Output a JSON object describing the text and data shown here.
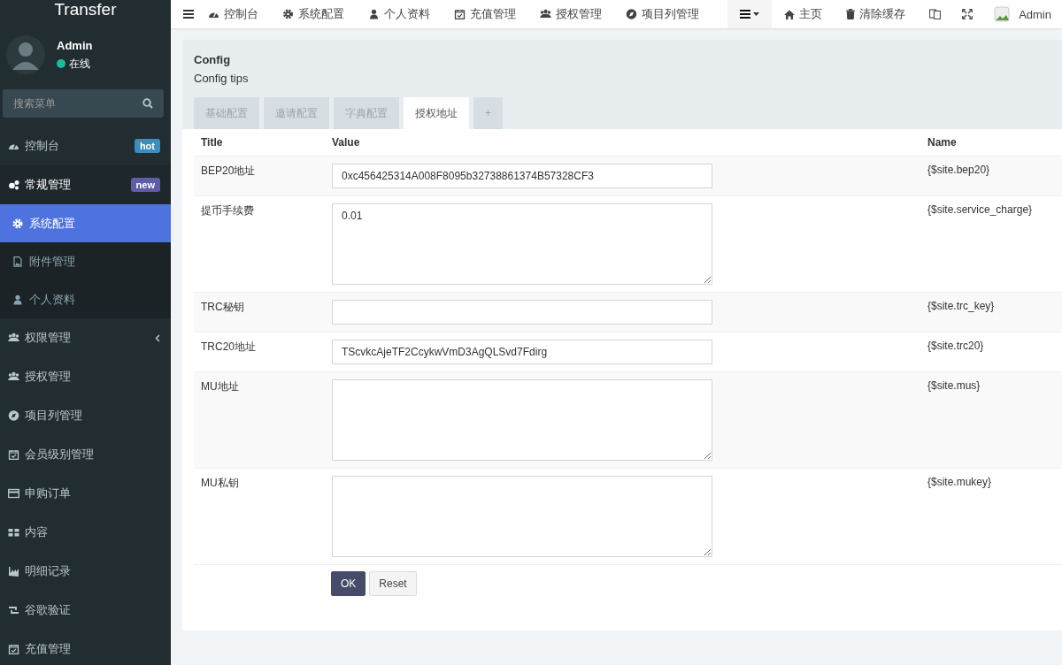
{
  "sidebar": {
    "logo": "Transfer",
    "user": {
      "name": "Admin",
      "status": "在线"
    },
    "search": {
      "placeholder": "搜索菜单"
    },
    "items": [
      {
        "label": "控制台",
        "badge": "hot",
        "color": "#3c8dbc",
        "selected": false,
        "expanded": false
      },
      {
        "label": "常规管理",
        "badge": "new",
        "color": "#605ca8",
        "selected": false,
        "expanded": true,
        "children": [
          {
            "label": "系统配置",
            "selected": true
          },
          {
            "label": "附件管理",
            "selected": false
          },
          {
            "label": "个人资料",
            "selected": false
          }
        ]
      },
      {
        "label": "权限管理",
        "selected": false,
        "expanded": false,
        "has_children": true
      },
      {
        "label": "授权管理",
        "selected": false,
        "expanded": false
      },
      {
        "label": "项目列管理",
        "selected": false,
        "expanded": false
      },
      {
        "label": "会员级别管理",
        "selected": false,
        "expanded": false
      },
      {
        "label": "申购订单",
        "selected": false,
        "expanded": false
      },
      {
        "label": "内容",
        "selected": false,
        "expanded": false
      },
      {
        "label": "明细记录",
        "selected": false,
        "expanded": false
      },
      {
        "label": "谷歌验证",
        "selected": false,
        "expanded": false
      },
      {
        "label": "充值管理",
        "selected": false,
        "expanded": false
      }
    ]
  },
  "topbar": {
    "nav": [
      "控制台",
      "系统配置",
      "个人资料",
      "充值管理",
      "授权管理",
      "项目列管理"
    ],
    "home": "主页",
    "clear_cache": "清除缓存",
    "user": "Admin"
  },
  "panel": {
    "title": "Config",
    "tips": "Config tips",
    "tabs": [
      {
        "label": "基础配置",
        "selected": false
      },
      {
        "label": "邀请配置",
        "selected": false
      },
      {
        "label": "字典配置",
        "selected": false
      },
      {
        "label": "授权地址",
        "selected": true
      },
      {
        "label": "+",
        "selected": false
      }
    ],
    "table": {
      "columns": [
        "Title",
        "Value",
        "Name"
      ],
      "rows": [
        {
          "title": "BEP20地址",
          "kind": "input",
          "value": "0xc456425314A008F8095b32738861374B57328CF3",
          "name": "{$site.bep20}"
        },
        {
          "title": "提币手续费",
          "kind": "textarea",
          "value": "0.01",
          "name": "{$site.service_charge}"
        },
        {
          "title": "TRC秘钥",
          "kind": "input",
          "value": "",
          "name": "{$site.trc_key}"
        },
        {
          "title": "TRC20地址",
          "kind": "input",
          "value": "TScvkcAjeTF2CcykwVmD3AgQLSvd7Fdirg",
          "name": "{$site.trc20}"
        },
        {
          "title": "MU地址",
          "kind": "textarea",
          "value": "",
          "name": "{$site.mus}"
        },
        {
          "title": "MU私钥",
          "kind": "textarea",
          "value": "",
          "name": "{$site.mukey}"
        }
      ]
    },
    "buttons": {
      "ok": "OK",
      "reset": "Reset"
    }
  }
}
